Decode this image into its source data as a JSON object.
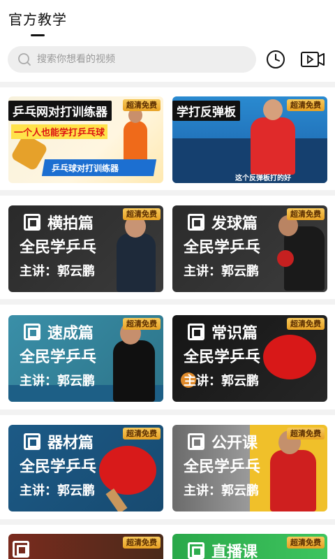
{
  "header": {
    "title": "官方教学"
  },
  "search": {
    "placeholder": "搜索你想看的视频"
  },
  "icons": {
    "search": "search-icon",
    "history": "clock-icon",
    "video": "video-camera-icon"
  },
  "colors": {
    "badge": "#f0b23a",
    "divider": "#f2f2f2"
  },
  "cards": [
    {
      "title": "乒乓网对打训练器",
      "subtitle": "一个人也能学打乒乓球",
      "banner": "乒乓球对打训练器",
      "badge": "超清免费"
    },
    {
      "title": "学打反弹板",
      "caption": "这个反弹板打的好",
      "badge": "超清免费"
    },
    {
      "title": "横拍篇",
      "brand": "全民学乒乓",
      "lecturer": "主讲：郭云鹏",
      "badge": "超清免费"
    },
    {
      "title": "发球篇",
      "brand": "全民学乒乓",
      "lecturer": "主讲：郭云鹏",
      "badge": "超清免费"
    },
    {
      "title": "速成篇",
      "brand": "全民学乒乓",
      "lecturer": "主讲：郭云鹏",
      "badge": "超清免费"
    },
    {
      "title": "常识篇",
      "brand": "全民学乒乓",
      "lecturer": "主讲：郭云鹏",
      "badge": "超清免费"
    },
    {
      "title": "器材篇",
      "brand": "全民学乒乓",
      "lecturer": "主讲：郭云鹏",
      "badge": "超清免费"
    },
    {
      "title": "公开课",
      "brand": "全民学乒乓",
      "lecturer": "主讲：郭云鹏",
      "badge": "超清免费"
    },
    {
      "title": "",
      "badge": "超清免费"
    },
    {
      "title": "直播课",
      "badge": "超清免费"
    }
  ]
}
